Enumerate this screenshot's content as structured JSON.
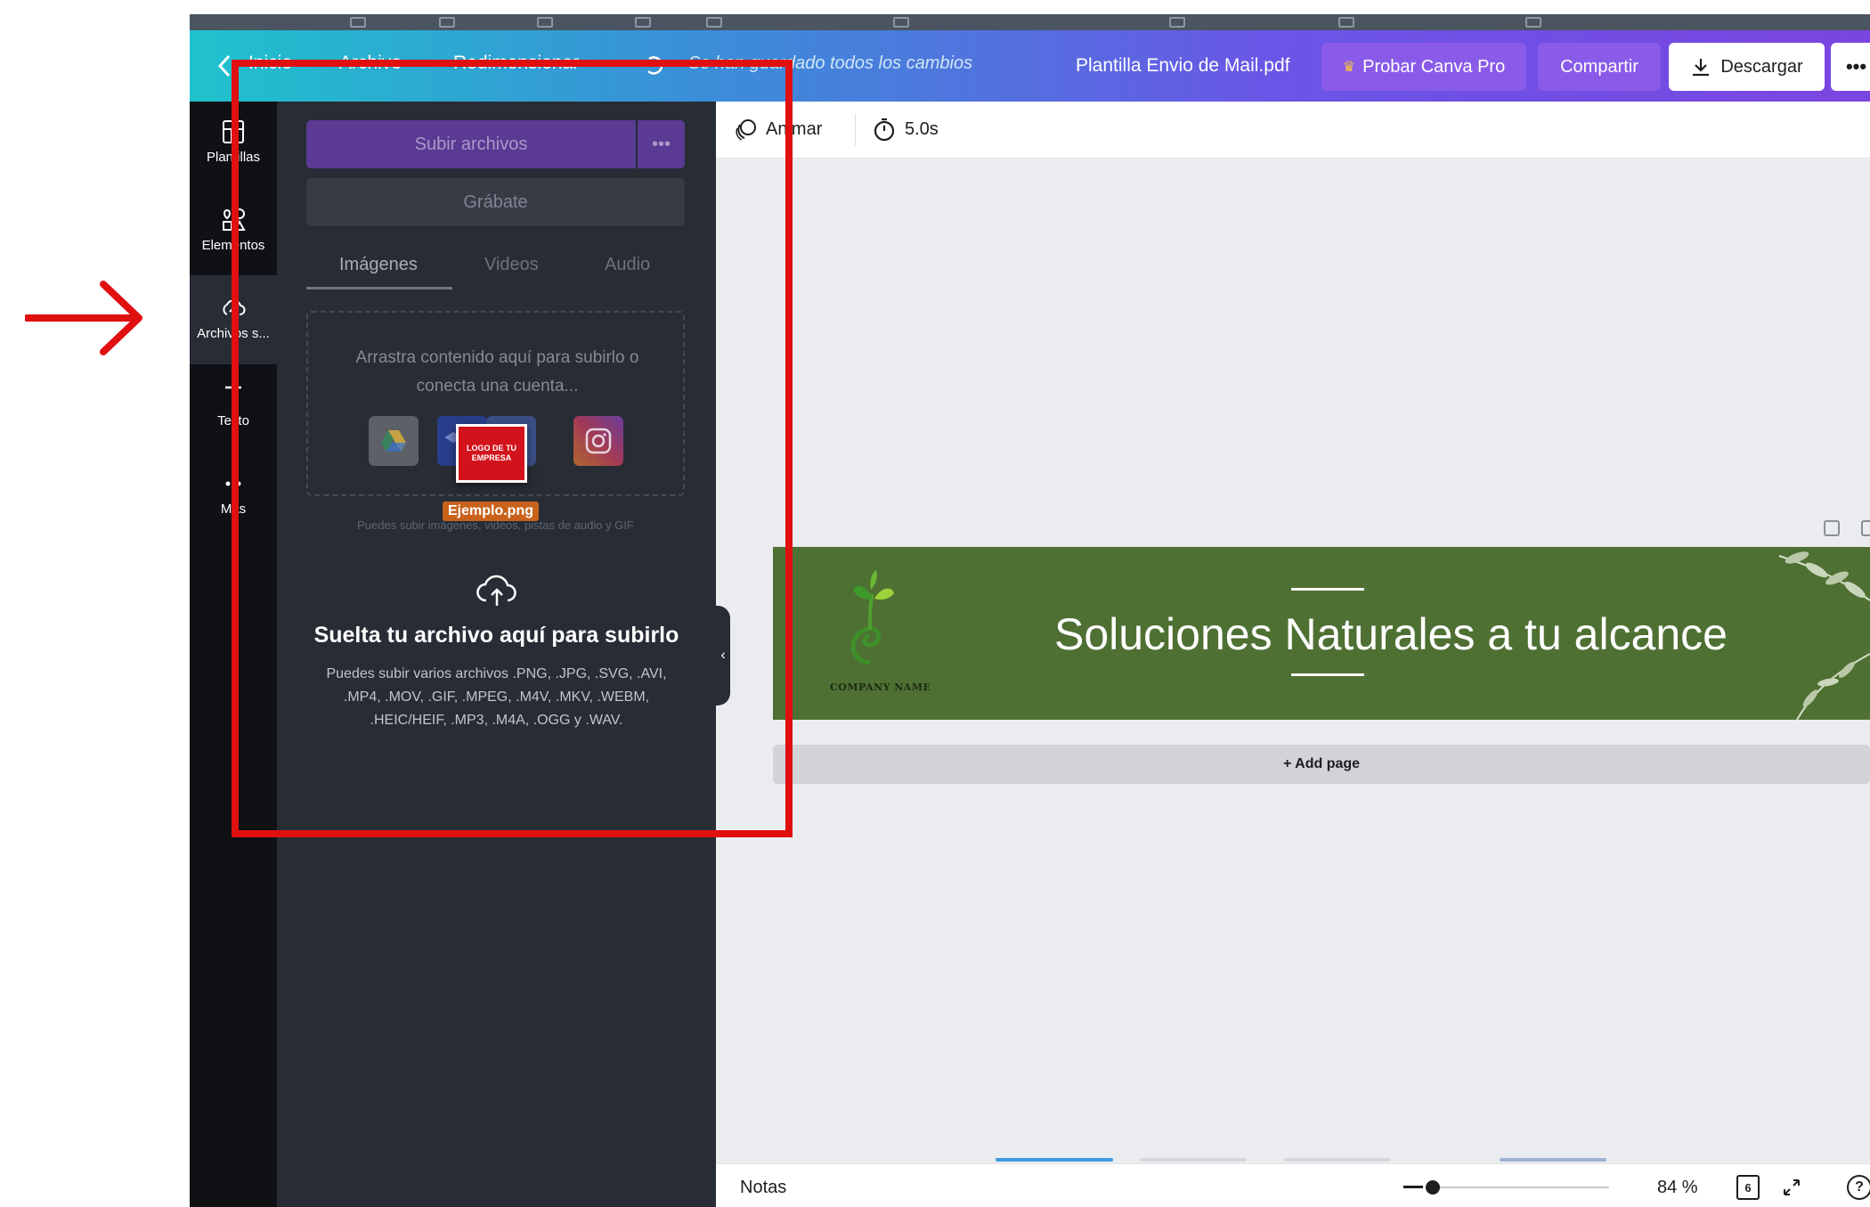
{
  "topbar": {
    "home_label": "Inicio",
    "file_label": "Archivo",
    "resize_label": "Redimensionar",
    "saved_status": "Se han guardado todos los cambios",
    "doc_title": "Plantilla Envio de Mail.pdf",
    "pro_label": "Probar Canva Pro",
    "share_label": "Compartir",
    "download_label": "Descargar",
    "more_label": "•••"
  },
  "rail": {
    "items": [
      {
        "label": "Plantillas",
        "icon": "template-icon"
      },
      {
        "label": "Elementos",
        "icon": "shapes-icon"
      },
      {
        "label": "Archivos s...",
        "icon": "cloud-upload-icon"
      },
      {
        "label": "Texto",
        "icon": "text-icon"
      },
      {
        "label": "Más",
        "icon": "more-dots-icon"
      }
    ]
  },
  "panel": {
    "upload_label": "Subir archivos",
    "upload_more": "•••",
    "record_label": "Grábate",
    "tabs": [
      "Imágenes",
      "Videos",
      "Audio"
    ],
    "dropzone_text": "Arrastra contenido aquí para subirlo o conecta una cuenta...",
    "hint": "Puedes subir imágenes, videos, pistas de audio y GIF",
    "drag_logo_text": "LOGO DE TU EMPRESA",
    "drag_filename": "Ejemplo.png",
    "drop_title": "Suelta tu archivo aquí para subirlo",
    "drop_desc": "Puedes subir varios archivos .PNG, .JPG, .SVG, .AVI, .MP4, .MOV, .GIF, .MPEG, .M4V, .MKV, .WEBM, .HEIC/HEIF, .MP3, .M4A, .OGG y .WAV.",
    "collapse_icon": "‹"
  },
  "toolbar": {
    "animate_label": "Animar",
    "duration": "5.0s"
  },
  "design": {
    "headline": "Soluciones Naturales a tu alcance",
    "company": "COMPANY NAME",
    "bg_color": "#4f7033"
  },
  "canvas": {
    "add_page": "+ Add page"
  },
  "bottombar": {
    "notes_label": "Notas",
    "zoom_value": "84 %",
    "pages_count": "6",
    "help_label": "?"
  },
  "colors": {
    "annotation_red": "#e01010",
    "canva_purple": "#8a5be8"
  }
}
